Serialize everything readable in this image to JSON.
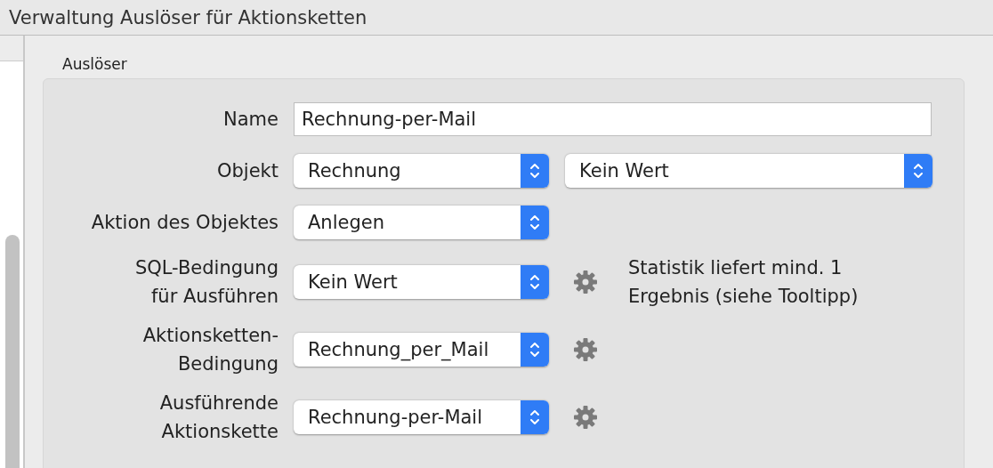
{
  "window": {
    "title": "Verwaltung Auslöser für Aktionsketten"
  },
  "section": {
    "title": "Auslöser"
  },
  "rows": [
    {
      "kind": "text",
      "label": [
        "Name"
      ],
      "value": "Rechnung-per-Mail"
    },
    {
      "kind": "select",
      "label": [
        "Objekt"
      ],
      "value": "Rechnung",
      "second_value": "Kein Wert"
    },
    {
      "kind": "select",
      "label": [
        "Aktion des Objektes"
      ],
      "value": "Anlegen"
    },
    {
      "kind": "select",
      "label": [
        "SQL-Bedingung",
        "für Ausführen"
      ],
      "value": "Kein Wert",
      "settings": true,
      "note": "Statistik liefert mind. 1 Ergebnis (siehe Tooltipp)"
    },
    {
      "kind": "select",
      "label": [
        "Aktionsketten-",
        "Bedingung"
      ],
      "value": "Rechnung_per_Mail",
      "settings": true
    },
    {
      "kind": "select",
      "label": [
        "Ausführende",
        "Aktionskette"
      ],
      "value": "Rechnung-per-Mail",
      "settings": true
    }
  ]
}
